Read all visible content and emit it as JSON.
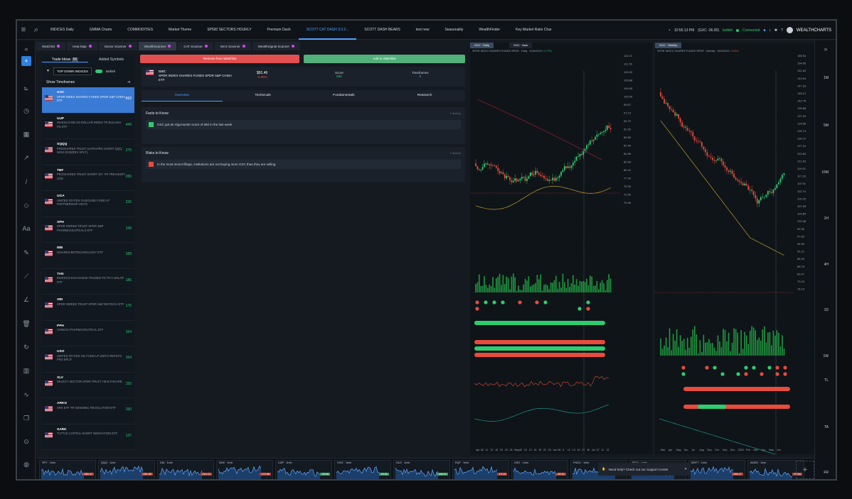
{
  "topbar": {
    "tabs": [
      "INDICES Daily",
      "GMMA Charts",
      "COMMODITIES",
      "Market Theme",
      "SP500 SECTORS HOURLY",
      "Premium Dash",
      "SCOTT CAT DASH 3.0.2...",
      "SCOTT DASH BEARS",
      "test new",
      "Seasonality",
      "WealthFinder",
      "Key Market Ratio Char"
    ],
    "active_index": 6,
    "time": "10:55:13 PM",
    "gxc_status": "(GXC -36.00)",
    "cnn_label": "bullish",
    "connected": "Connected",
    "brand": "WEALTHCHARTS"
  },
  "subtabs": [
    "Watchlist",
    "Heat Map",
    "Sector Scanner",
    "WealthScanner",
    "CAT Scanner",
    "MAX Scanner",
    "WealthSignal Scanner"
  ],
  "list": {
    "tabs": [
      "Trade Ideas",
      "Added Symbols"
    ],
    "trade_ideas_count": "56",
    "filter": "TOP DOWN INDICES",
    "bullish_label": "Bullish",
    "show_timeframes": "Show Timeframes",
    "rows": [
      {
        "ticker": "GXC",
        "name": "SPDR INDEX SHARES FUNDS SPDR S&P CHINA ETF",
        "score": "692"
      },
      {
        "ticker": "UUP",
        "name": "INVESCO DB US DOLLAR INDEX TR BULLISH FD ETF",
        "score": "449"
      },
      {
        "ticker": "SQQQ",
        "name": "PROSHARES TRUST ULTRAPRO SHORT QQQ NEW 2023(REV SPLT)",
        "score": "275"
      },
      {
        "ticker": "TBF",
        "name": "PROSHARES TRUST SHORT 20+ YR TREASURY USD",
        "score": "283"
      },
      {
        "ticker": "UGA",
        "name": "UNITED STATES GASOLINE FUND LP PARTNERSHIP UNITS",
        "score": "235"
      },
      {
        "ticker": "XPH",
        "name": "SPDR SERIES TRUST SPDR S&P PHARMACEUTICALS ETF",
        "score": "198"
      },
      {
        "ticker": "IBB",
        "name": "ISHARES BIOTECHNOLOGY ETF",
        "score": "189"
      },
      {
        "ticker": "TAN",
        "name": "INVESCO EXCHANGE TRADED FD TR II SOLAR ETF",
        "score": "186"
      },
      {
        "ticker": "XBI",
        "name": "SPDR SERIES TRUST SPDR S&P BIOTECH ETF",
        "score": "175"
      },
      {
        "ticker": "PPH",
        "name": "VANECK PHARMACEUTICAL ETF",
        "score": "164"
      },
      {
        "ticker": "USO",
        "name": "UNITED STATES OIL FUND LP UNITS REPSTG PFD SPLIT",
        "score": "164"
      },
      {
        "ticker": "XLV",
        "name": "SELECT SECTOR SPDR TRUST HEALTHCARE",
        "score": "150"
      },
      {
        "ticker": "ARKG",
        "name": "ARK ETF TR GENOMIC REVOLUTION ETF",
        "score": "150"
      },
      {
        "ticker": "SARK",
        "name": "TUTTLE CAPITAL SHORT INNOVATION ETF",
        "score": "137"
      }
    ]
  },
  "detail": {
    "remove_label": "Remove from Watchlist",
    "add_label": "Add to Watchlist",
    "symbol": "GXC",
    "symbol_name": "SPDR INDEX SHARES FUNDS SPDR S&P CHINA ETF",
    "price": "$91.46",
    "change": "-0.55%",
    "score_label": "Score",
    "score_value": "692",
    "timeframes_label": "Timeframes",
    "timeframes_value": "0",
    "tabs": [
      "Overview",
      "Technicals",
      "Fundamentals",
      "Research"
    ],
    "facts_title": "Facts to Know",
    "facts_count": "1 item(s)",
    "fact": "GXC got an AlgoHunter score of 692 in the last week",
    "risks_title": "Risks to Know",
    "risks_count": "1 item(s)",
    "risk": "In the most recent filings, institutions are not buying more GXC than they are selling."
  },
  "chart1": {
    "tab": "GXC · Daily",
    "tab2": "GXC · Asia",
    "title": "SPDR INDEX SHARES FUNDS SPDR · Daily · 6/15/2023",
    "change": "+1.77%",
    "price_ticks": [
      "114.21",
      "111.78",
      "109.32",
      "106.88",
      "104.45",
      "102.00",
      "99.57",
      "97.13",
      "94.70",
      "92.26",
      "89.83",
      "87.40",
      "84.96",
      "82.53",
      "80.10",
      "77.76",
      "75.33",
      "72.90",
      "70.46"
    ],
    "x_ticks": [
      "Apr",
      "06",
      "11",
      "13",
      "18",
      "20",
      "24",
      "26",
      "May",
      "05",
      "10",
      "12",
      "16",
      "18",
      "22",
      "24",
      "Jun",
      "06",
      "8",
      "12",
      "14",
      "16",
      "27",
      "28",
      "Jul",
      "07",
      "11",
      "13"
    ]
  },
  "chart2": {
    "tab": "GXC · Weekly",
    "title": "SPDR INDEX SHARES FUNDS SPDR · Weekly · 6/15/2023",
    "change": "-0.55%",
    "price_ticks": [
      "156.94",
      "154.05",
      "151.62",
      "149.94",
      "147.33",
      "145.21",
      "142.75",
      "139.65",
      "137.43",
      "134.96",
      "132.74",
      "130.12",
      "127.24",
      "124.84",
      "121.92",
      "119.51",
      "117.20",
      "114.91",
      "112.74",
      "110.25",
      "107.53",
      "104.80",
      "102.08",
      "99.35",
      "97.63",
      "94.90",
      "91.21",
      "88.49",
      "85.75",
      "82.07",
      "79.43",
      "76.10"
    ],
    "x_ticks": [
      "Mar",
      "Apr",
      "May",
      "Jun",
      "Jul",
      "Aug",
      "Sep",
      "Oct",
      "Nov",
      "Dec",
      "2023",
      "Feb",
      "Mar",
      "Apr",
      "May",
      "Jun"
    ]
  },
  "timeframes": [
    "1M",
    "5M",
    "15M",
    "1H",
    "4H",
    "1D",
    "1W",
    "1MTH"
  ],
  "right_labels": [
    "TL",
    "TA",
    "FR"
  ],
  "support": "Need help? Check out our Support Center",
  "minis": [
    {
      "label": "SPY · 1min",
      "price": "380.37"
    },
    {
      "label": "QQQ · 1min",
      "price": "281.89"
    },
    {
      "label": "DIA · 1min",
      "price": "310.13"
    },
    {
      "label": "IWM · 1min",
      "price": "170.69"
    },
    {
      "label": "UUP · 1min",
      "price": "28.08"
    },
    {
      "label": "VIXX · 1min",
      "price": "33.61"
    },
    {
      "label": "GLD · 1min",
      "price": "168.31"
    },
    {
      "label": "EQF · 1min",
      "price": "19.15"
    },
    {
      "label": "USO · 1min",
      "price": "82.91"
    },
    {
      "label": "FNGU · 1min",
      "price": "26.90"
    },
    {
      "label": "FFTY · 1min",
      "price": "26.90"
    },
    {
      "label": "MSFT · 1min",
      "price": "260.27"
    },
    {
      "label": "AMZN · 1min",
      "price": "98.54"
    }
  ],
  "colors": {
    "up": "#2ecc71",
    "down": "#e74c3c",
    "accent": "#4aa3ff"
  }
}
